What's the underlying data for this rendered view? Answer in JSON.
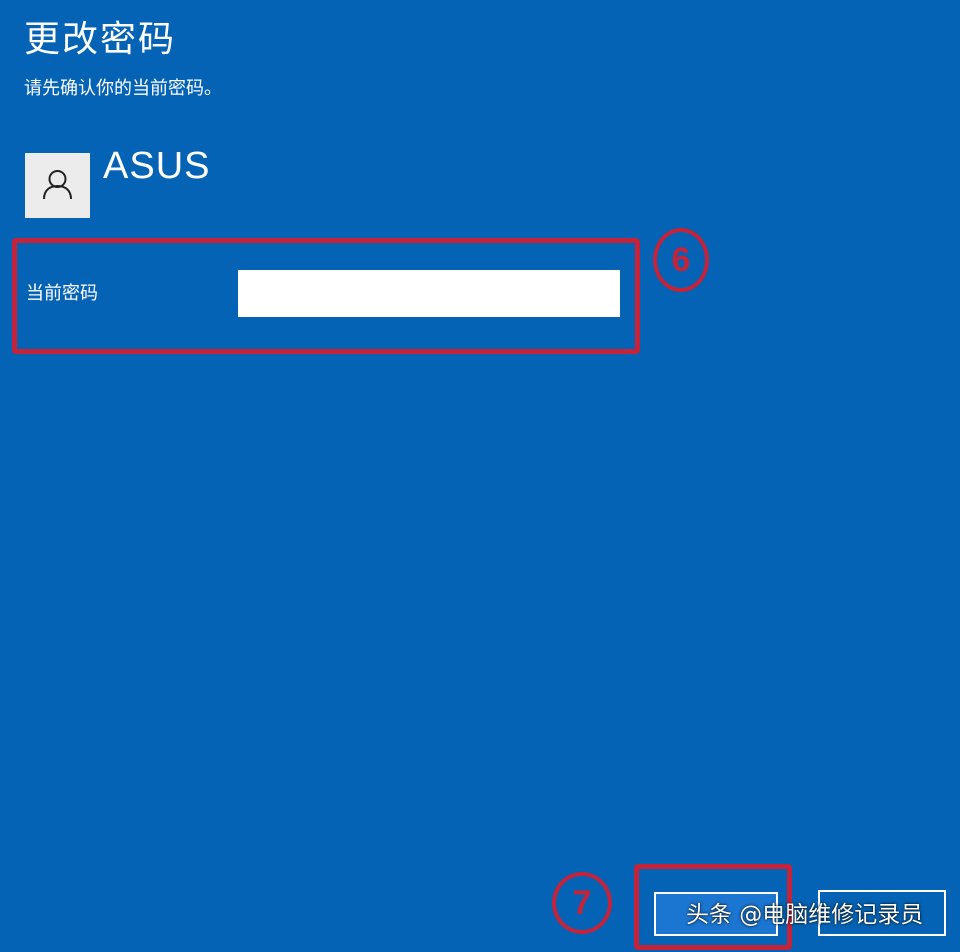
{
  "dialog": {
    "title": "更改密码",
    "subtitle": "请先确认你的当前密码。"
  },
  "account": {
    "avatar_icon": "user-icon",
    "name": "ASUS"
  },
  "password_field": {
    "label": "当前密码",
    "value": "",
    "placeholder": ""
  },
  "annotations": {
    "step_6": "6",
    "step_7": "7",
    "color": "#c4233a"
  },
  "buttons": {
    "next_label": "",
    "cancel_label": ""
  },
  "watermark": "头条 @电脑维修记录员",
  "colors": {
    "background": "#0563b5",
    "accent_button": "#1b76d2"
  }
}
